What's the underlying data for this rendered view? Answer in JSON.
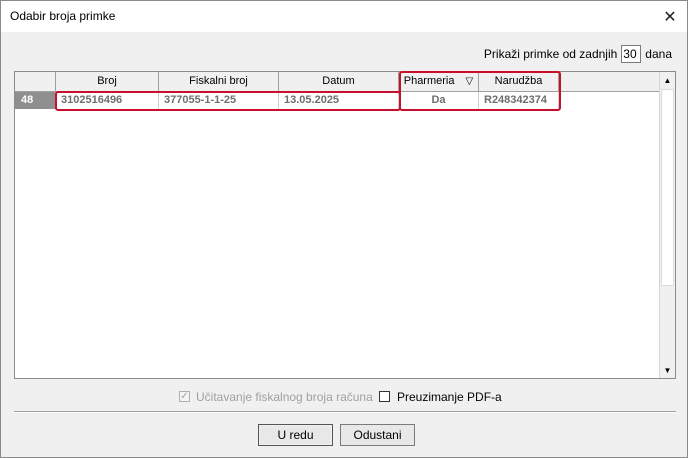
{
  "window": {
    "title": "Odabir broja primke",
    "close_glyph": "✕"
  },
  "filter": {
    "label_before": "Prikaži primke od zadnjih",
    "days_value": "30",
    "label_after": "dana"
  },
  "grid": {
    "columns": [
      "Broj",
      "Fiskalni broj",
      "Datum",
      "Pharmeria",
      "Narudžba"
    ],
    "sort_icon": "▽",
    "rows": [
      {
        "num": "48",
        "broj": "3102516496",
        "fiskalni": "377055-1-1-25",
        "datum": "13.05.2025",
        "pharmeria": "Da",
        "narudzba": "R248342374"
      }
    ]
  },
  "options": {
    "fiscal_label": "Učitavanje fiskalnog broja računa",
    "fiscal_checked": true,
    "fiscal_disabled": true,
    "pdf_label": "Preuzimanje PDF-a",
    "pdf_checked": false
  },
  "buttons": {
    "ok_label": "U redu",
    "cancel_label": "Odustani"
  },
  "colors": {
    "highlight": "#c8102e"
  },
  "icons": {
    "close": "close-icon",
    "sort": "sort-filter-icon",
    "scroll_up": "arrow-up-icon",
    "scroll_down": "arrow-down-icon",
    "check": "checkmark-icon"
  }
}
